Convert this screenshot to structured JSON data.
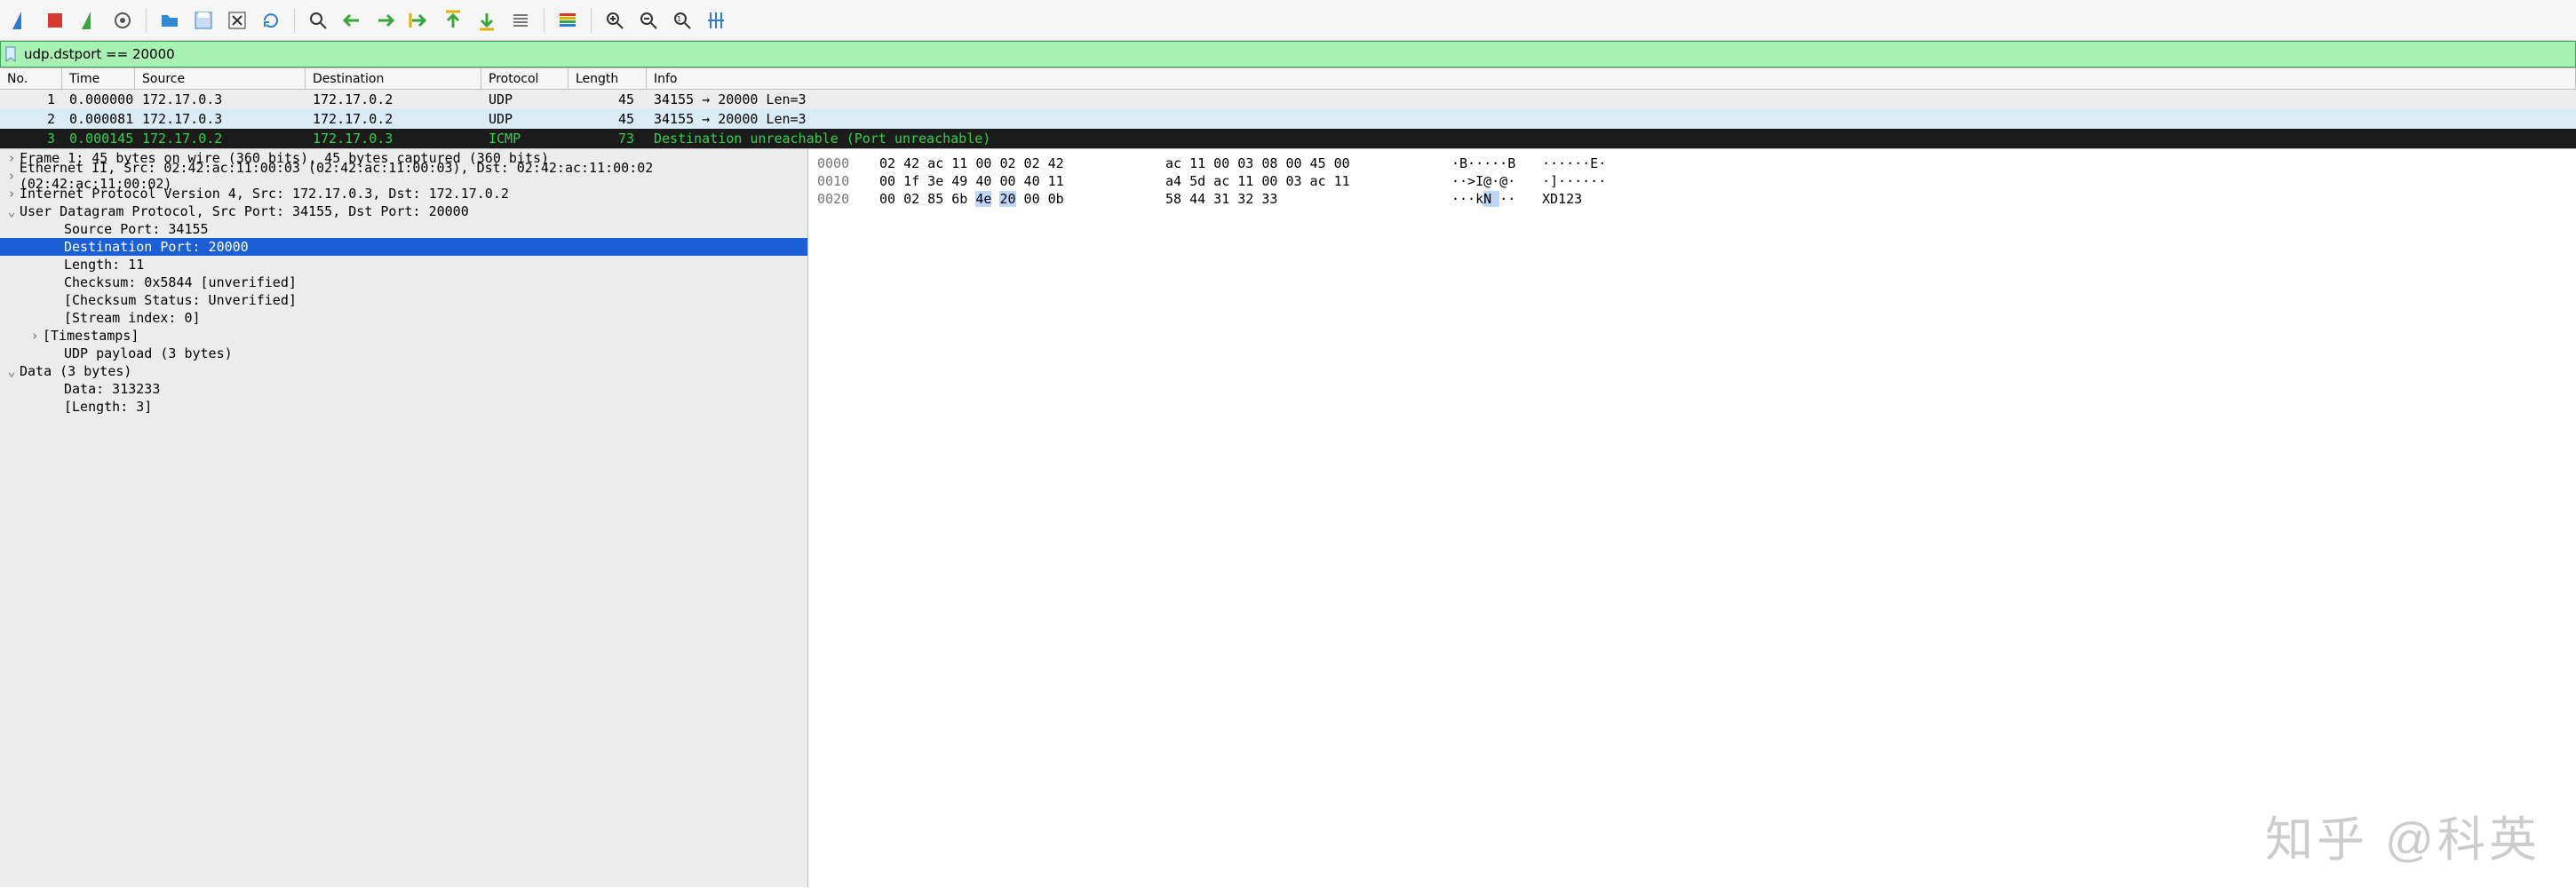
{
  "toolbar": {
    "buttons": [
      "fin-icon",
      "stop-icon",
      "restart-icon",
      "options-icon",
      "open-icon",
      "save-icon",
      "close-icon",
      "reload-icon",
      "find-icon",
      "prev-icon",
      "next-icon",
      "goto-icon",
      "first-icon",
      "last-icon",
      "autoscroll-icon",
      "colorize-icon",
      "zoom-in-icon",
      "zoom-out-icon",
      "zoom-reset-icon",
      "resize-cols-icon"
    ]
  },
  "filter": {
    "value": "udp.dstport == 20000"
  },
  "packet_list": {
    "columns": [
      "No.",
      "Time",
      "Source",
      "Destination",
      "Protocol",
      "Length",
      "Info"
    ],
    "rows": [
      {
        "no": "1",
        "time": "0.000000",
        "src": "172.17.0.3",
        "dst": "172.17.0.2",
        "prot": "UDP",
        "len": "45",
        "info": "34155 → 20000 Len=3",
        "bg": "#ececec",
        "fg": "#000"
      },
      {
        "no": "2",
        "time": "0.000081",
        "src": "172.17.0.3",
        "dst": "172.17.0.2",
        "prot": "UDP",
        "len": "45",
        "info": "34155 → 20000 Len=3",
        "bg": "#d9ecf6",
        "fg": "#000"
      },
      {
        "no": "3",
        "time": "0.000145",
        "src": "172.17.0.2",
        "dst": "172.17.0.3",
        "prot": "ICMP",
        "len": "73",
        "info": "Destination unreachable (Port unreachable)",
        "bg": "#1b1b1b",
        "fg": "#34d14a"
      }
    ]
  },
  "tree": [
    {
      "t": "Frame 1: 45 bytes on wire (360 bits), 45 bytes captured (360 bits)",
      "exp": ">",
      "lvl": 0
    },
    {
      "t": "Ethernet II, Src: 02:42:ac:11:00:03 (02:42:ac:11:00:03), Dst: 02:42:ac:11:00:02 (02:42:ac:11:00:02)",
      "exp": ">",
      "lvl": 0
    },
    {
      "t": "Internet Protocol Version 4, Src: 172.17.0.3, Dst: 172.17.0.2",
      "exp": ">",
      "lvl": 0
    },
    {
      "t": "User Datagram Protocol, Src Port: 34155, Dst Port: 20000",
      "exp": "v",
      "lvl": 0
    },
    {
      "t": "Source Port: 34155",
      "exp": "",
      "lvl": 2
    },
    {
      "t": "Destination Port: 20000",
      "exp": "",
      "lvl": 2,
      "sel": true
    },
    {
      "t": "Length: 11",
      "exp": "",
      "lvl": 2
    },
    {
      "t": "Checksum: 0x5844 [unverified]",
      "exp": "",
      "lvl": 2
    },
    {
      "t": "[Checksum Status: Unverified]",
      "exp": "",
      "lvl": 2
    },
    {
      "t": "[Stream index: 0]",
      "exp": "",
      "lvl": 2
    },
    {
      "t": "[Timestamps]",
      "exp": ">",
      "lvl": 1
    },
    {
      "t": "UDP payload (3 bytes)",
      "exp": "",
      "lvl": 2
    },
    {
      "t": "Data (3 bytes)",
      "exp": "v",
      "lvl": 0
    },
    {
      "t": "Data: 313233",
      "exp": "",
      "lvl": 2
    },
    {
      "t": "[Length: 3]",
      "exp": "",
      "lvl": 2
    }
  ],
  "hex": [
    {
      "off": "0000",
      "b1": "02 42 ac 11 00 02 02 42",
      "b2": "ac 11 00 03 08 00 45 00",
      "a1": "·B·····B",
      "a2": "······E·"
    },
    {
      "off": "0010",
      "b1": "00 1f 3e 49 40 00 40 11",
      "b2": "a4 5d ac 11 00 03 ac 11",
      "a1": "··>I@·@·",
      "a2": "·]······"
    },
    {
      "off": "0020",
      "b1": "00 02 85 6b 4e 20 00 0b",
      "b1hi": [
        4,
        5
      ],
      "b2": "58 44 31 32 33",
      "a1": "···kN ··",
      "a1hi": [
        4,
        5
      ],
      "a2": "XD123"
    }
  ],
  "watermark": "知乎 @科英"
}
